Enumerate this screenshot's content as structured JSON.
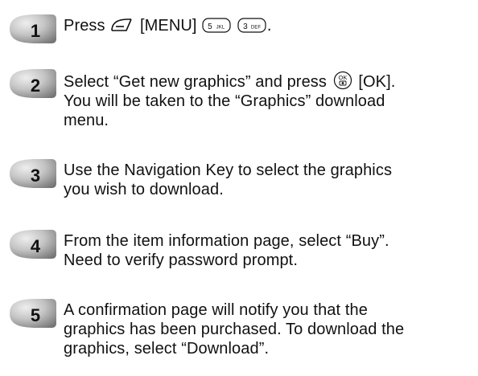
{
  "steps": [
    {
      "number": "1",
      "before": "Press",
      "menu_label": "[MENU]",
      "after": ".",
      "key_a": "5",
      "key_a_sub": "JKL",
      "key_b": "3",
      "key_b_sub": "DEF"
    },
    {
      "number": "2",
      "before": "Select “Get new graphics” and press",
      "ok_key": "OK",
      "after": "[OK].",
      "line2": "You will be taken to the “Graphics” download",
      "line3": "menu."
    },
    {
      "number": "3",
      "line1": "Use the Navigation Key to select the graphics",
      "line2": "you wish to download."
    },
    {
      "number": "4",
      "line1": "From the item information page, select “Buy”.",
      "line2": "Need to verify password prompt."
    },
    {
      "number": "5",
      "line1": "A confirmation page will notify you that the",
      "line2": "graphics has been purchased. To download the",
      "line3": "graphics, select “Download”."
    }
  ],
  "colors": {
    "text": "#111111",
    "badge_dark": "#7a7a7a",
    "badge_light": "#e4e4e4"
  },
  "icons": {
    "softkey": "left-softkey-icon",
    "ok": "ok-camera-key-icon"
  }
}
